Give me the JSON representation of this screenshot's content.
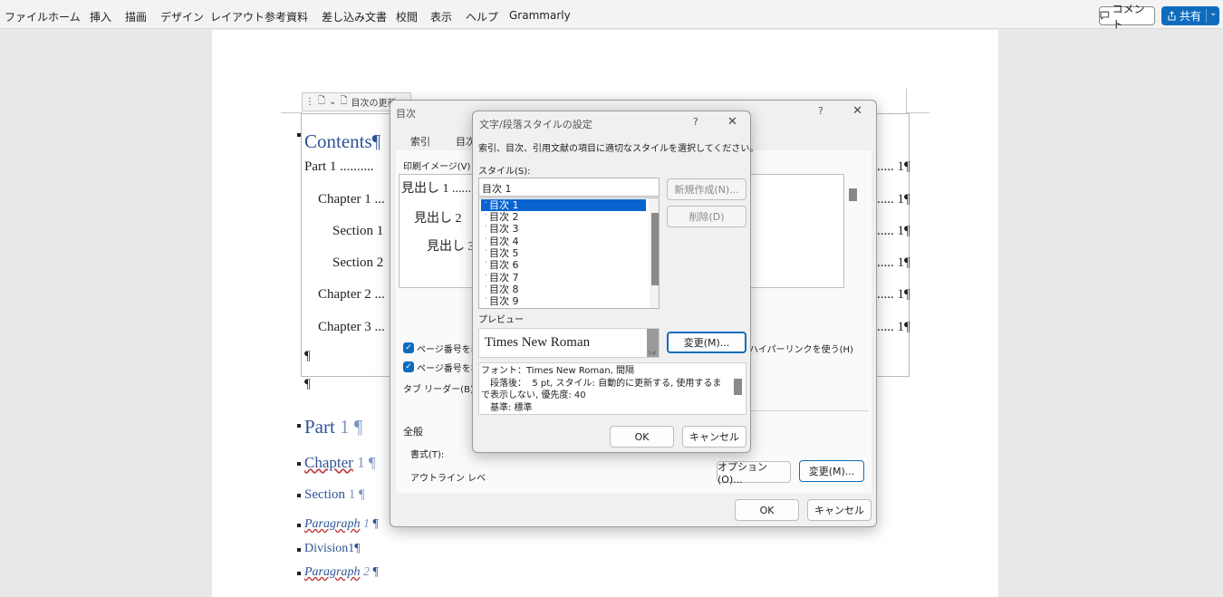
{
  "menu": {
    "items": [
      "ファイル",
      "ホーム",
      "挿入",
      "描画",
      "デザイン",
      "レイアウト",
      "参考資料",
      "差し込み文書",
      "校閲",
      "表示",
      "ヘルプ",
      "Grammarly"
    ],
    "comment": "コメント",
    "share": "共有"
  },
  "doc": {
    "toc_toolbar_label": "目次の更新",
    "contents": "Contents¶",
    "toc_lines": [
      {
        "label": "Part 1 ..........",
        "page": "..... 1¶"
      },
      {
        "label": "Chapter 1 ...",
        "page": "..... 1¶"
      },
      {
        "label": "Section 1",
        "page": "..... 1¶"
      },
      {
        "label": "Section 2",
        "page": "..... 1¶"
      },
      {
        "label": "Chapter 2 ...",
        "page": "..... 1¶"
      },
      {
        "label": "Chapter 3 ...",
        "page": "..... 1¶"
      }
    ],
    "pilcrow": "¶",
    "headings": {
      "part": "Part",
      "part_num": "1 ¶",
      "chapter": "Chapter",
      "chapter_num": "1 ¶",
      "section": "Section",
      "section_num": "1 ¶",
      "para1": "Paragraph",
      "para1_num": "1",
      "division": "Division1¶",
      "para2": "Paragraph",
      "para2_num": "2"
    }
  },
  "toc_dialog": {
    "title": "目次",
    "help": "?",
    "tabs": [
      "索引",
      "目次"
    ],
    "print_preview_label": "印刷イメージ(V)",
    "preview_lines": [
      "見出し 1 ......",
      "見出し 2",
      "見出し 3"
    ],
    "show_page_numbers": "ページ番号を表",
    "right_align": "ページ番号を右",
    "hyperlink": "ハイパーリンクを使う(H)",
    "tab_leader": "タブ リーダー(B):",
    "general": "全般",
    "format": "書式(T):",
    "outline_level": "アウトライン レベ",
    "options_button": "オプション(O)...",
    "modify_button": "変更(M)...",
    "ok": "OK",
    "cancel": "キャンセル"
  },
  "style_dialog": {
    "title": "文字/段落スタイルの設定",
    "help": "?",
    "instruction": "索引、目次、引用文献の項目に適切なスタイルを選択してください。",
    "styles_label": "スタイル(S):",
    "style_value": "目次 1",
    "style_list": [
      "目次 1",
      "目次 2",
      "目次 3",
      "目次 4",
      "目次 5",
      "目次 6",
      "目次 7",
      "目次 8",
      "目次 9"
    ],
    "new_button": "新規作成(N)...",
    "delete_button": "削除(D)",
    "preview_label": "プレビュー",
    "preview_font": "Times New Roman",
    "preview_size": "5 pt",
    "modify_button": "変更(M)...",
    "description": "フォント：Times New Roman, 間隔\n　段落後：  5 pt, スタイル: 自動的に更新する, 使用するまで表示しない, 優先度: 40\n　基準: 標準",
    "ok": "OK",
    "cancel": "キャンセル"
  }
}
